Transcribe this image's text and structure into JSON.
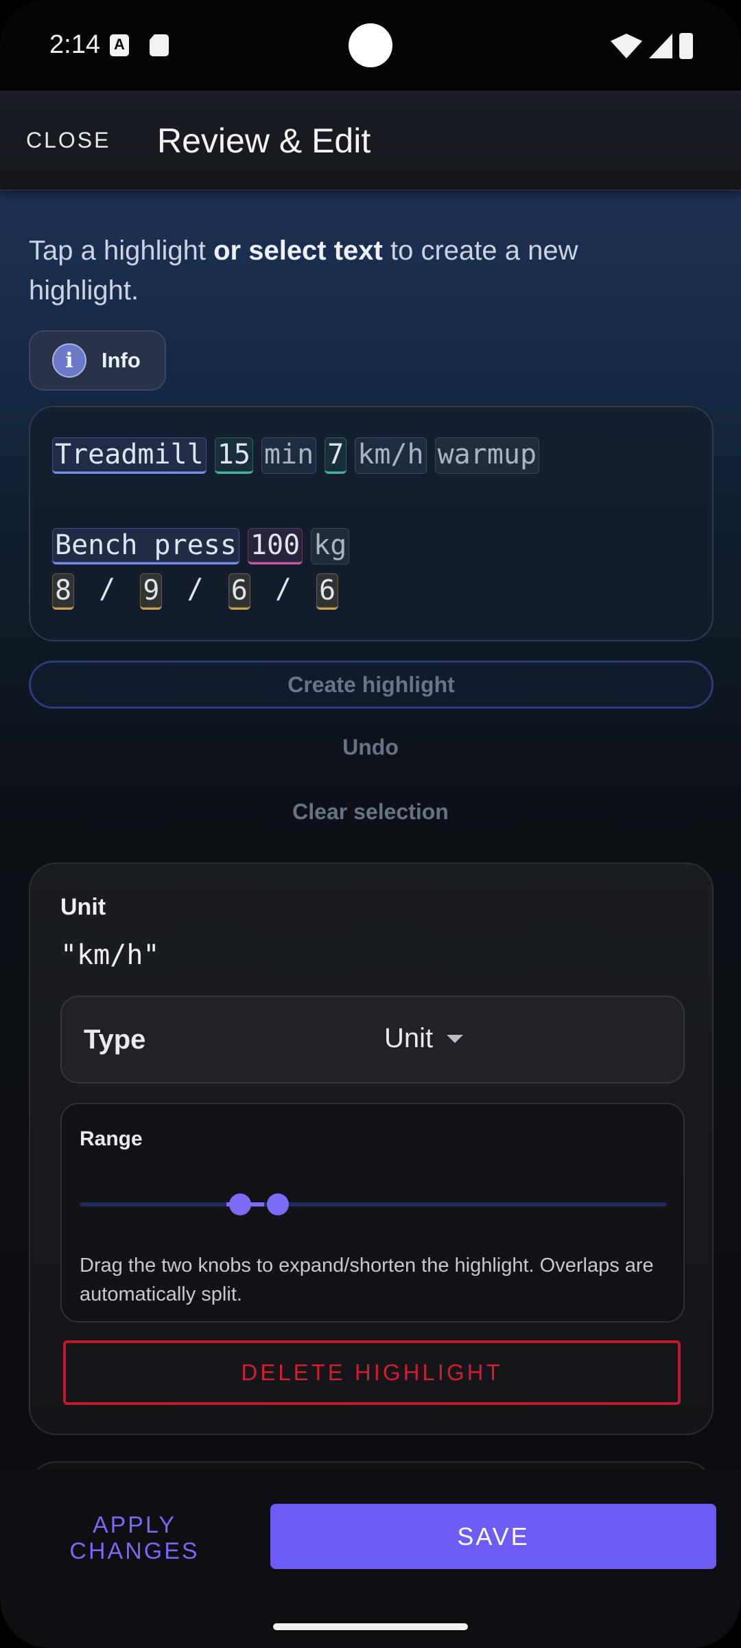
{
  "status_bar": {
    "time": "2:14",
    "icons": [
      "a-notification-icon",
      "sd-card-icon",
      "wifi-icon",
      "signal-icon",
      "battery-icon"
    ]
  },
  "app_bar": {
    "close_label": "CLOSE",
    "title": "Review & Edit"
  },
  "intro": {
    "part1": "Tap a highlight ",
    "bold": "or select text",
    "part2": " to create a new highlight."
  },
  "info_chip": {
    "icon_glyph": "i",
    "label": "Info"
  },
  "editor": {
    "line1": [
      {
        "text": "Treadmill",
        "kind": "exercise"
      },
      {
        "text": "15",
        "kind": "number"
      },
      {
        "text": "min",
        "kind": "unit"
      },
      {
        "text": "7",
        "kind": "number"
      },
      {
        "text": "km/h",
        "kind": "unit"
      },
      {
        "text": "warmup",
        "kind": "plain"
      }
    ],
    "line2": [
      {
        "text": "Bench press",
        "kind": "exercise"
      },
      {
        "text": "100",
        "kind": "weight"
      },
      {
        "text": "kg",
        "kind": "plain"
      }
    ],
    "line3": {
      "reps": [
        "8",
        "9",
        "6",
        "6"
      ],
      "separator": "/"
    }
  },
  "actions": {
    "create_highlight": "Create highlight",
    "undo": "Undo",
    "clear_selection": "Clear selection"
  },
  "highlight_card": {
    "label": "Unit",
    "value": "\"km/h\"",
    "type_label": "Type",
    "type_value": "Unit",
    "range_label": "Range",
    "range_help": "Drag the two knobs to expand/shorten the highlight. Overlaps are automatically split.",
    "delete_label": "DELETE HIGHLIGHT"
  },
  "bottom_bar": {
    "apply_line1": "APPLY",
    "apply_line2": "CHANGES",
    "save_label": "SAVE"
  },
  "colors": {
    "accent": "#6c5cf5",
    "danger": "#d01e30",
    "exercise": "#7c8ae8",
    "number": "#3fb7a3",
    "weight": "#c55aa8",
    "rep": "#c9a24c"
  }
}
